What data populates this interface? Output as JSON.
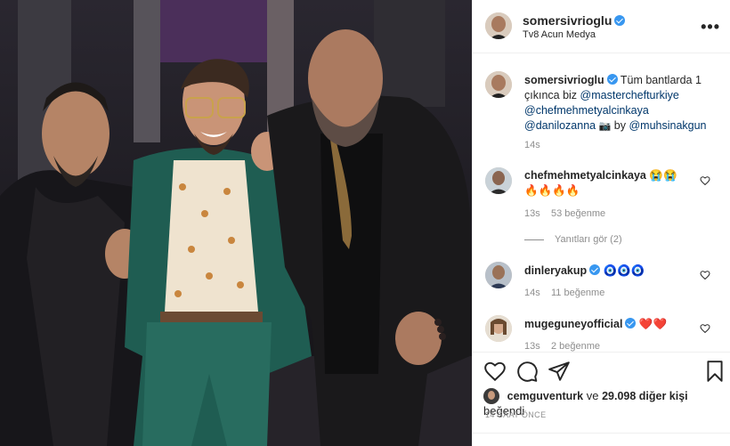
{
  "post": {
    "author": "somersivrioglu",
    "location": "Tv8 Acun Medya",
    "more_label": "•••"
  },
  "caption": {
    "author": "somersivrioglu",
    "text_start": "Tüm bantlarda 1",
    "text_line2": "çıkınca biz",
    "mentions": [
      "@masterchefturkiye",
      "@chefmehmetyalcinkaya",
      "@danilozanna"
    ],
    "by_label": "by",
    "photo_by": "@muhsinakgun",
    "time": "14s"
  },
  "comments": [
    {
      "user": "chefmehmetyalcinkaya",
      "text_line1": "😭😭",
      "text_line2": "🔥🔥🔥🔥",
      "time": "13s",
      "likes": "53 beğenme",
      "replies": "Yanıtları gör (2)"
    },
    {
      "user": "dinleryakup",
      "text": "🧿🧿🧿",
      "time": "14s",
      "likes": "11 beğenme"
    },
    {
      "user": "mugeguneyofficial",
      "text": "❤️❤️",
      "time": "13s",
      "likes": "2 beğenme"
    }
  ],
  "liked_by": {
    "user": "cemguventurk",
    "connector": "ve",
    "others": "29.098 diğer kişi",
    "suffix": "beğendi"
  },
  "posted_time": "14 SAAT ÖNCE",
  "colors": {
    "verified": "#3897f0",
    "mention": "#00376b",
    "meta": "#8e8e8e",
    "photo_bg": "#1b1a1f",
    "jacket_green": "#1f5d52"
  }
}
